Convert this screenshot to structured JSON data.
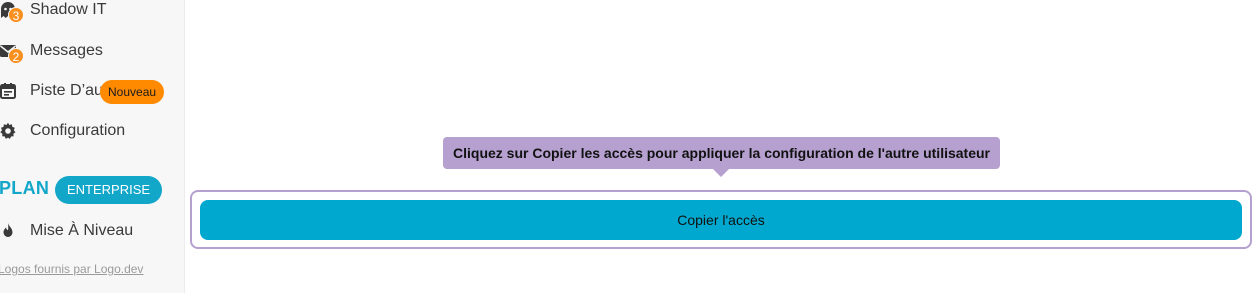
{
  "sidebar": {
    "items": [
      {
        "label": "Shadow IT",
        "icon": "ghost-icon",
        "count": "3"
      },
      {
        "label": "Messages",
        "icon": "envelope-icon",
        "count": "2"
      },
      {
        "label": "Piste D’au",
        "icon": "calendar-icon",
        "badge": "Nouveau"
      },
      {
        "label": "Configuration",
        "icon": "gear-icon"
      },
      {
        "label": "Mise À Niveau",
        "icon": "flame-icon"
      }
    ],
    "plan": {
      "title": "PLAN",
      "badge": "ENTERPRISE"
    },
    "logos_credit": "Logos fournis par Logo.dev"
  },
  "tooltip": {
    "text": "Cliquez sur Copier les accès pour appliquer la configuration de l'autre utilisateur"
  },
  "main": {
    "copy_button_label": "Copier l'accès"
  },
  "colors": {
    "accent": "#00a7cf",
    "tooltip": "#b5a0cf",
    "badge_orange": "#f7901e"
  }
}
